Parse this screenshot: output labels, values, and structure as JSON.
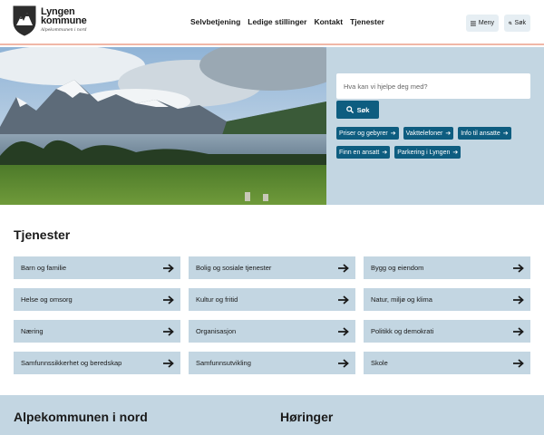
{
  "header": {
    "logo_line1": "Lyngen",
    "logo_line2": "kommune",
    "logo_tagline": "Alpekommunen i nord",
    "nav": [
      "Selvbetjening",
      "Ledige stillinger",
      "Kontakt",
      "Tjenester"
    ],
    "menu_label": "Meny",
    "search_label": "Søk"
  },
  "hero": {
    "search_placeholder": "Hva kan vi hjelpe deg med?",
    "search_button": "Søk",
    "quick_links": [
      "Priser og gebyrer",
      "Vakttelefoner",
      "Info til ansatte",
      "Finn en ansatt",
      "Parkering i Lyngen"
    ]
  },
  "services": {
    "title": "Tjenester",
    "items": [
      "Barn og familie",
      "Bolig og sosiale tjenester",
      "Bygg og eiendom",
      "Helse og omsorg",
      "Kultur og fritid",
      "Natur, miljø og klima",
      "Næring",
      "Organisasjon",
      "Politikk og demokrati",
      "Samfunnssikkerhet og beredskap",
      "Samfunnsutvikling",
      "Skole"
    ]
  },
  "bottom": {
    "left_heading": "Alpekommunen i nord",
    "right_heading": "Høringer"
  },
  "colors": {
    "accent": "#0e5d80",
    "light_blue": "#c3d6e2",
    "header_border": "#f0b7a7"
  }
}
